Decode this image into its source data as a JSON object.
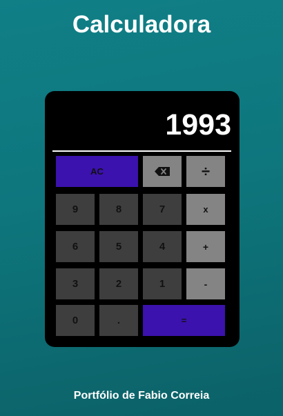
{
  "header": {
    "title": "Calculadora"
  },
  "display": {
    "value": "1993"
  },
  "keys": {
    "ac": "AC",
    "divide": "÷",
    "multiply": "x",
    "add": "+",
    "subtract": "-",
    "equals": "=",
    "decimal": ".",
    "d0": "0",
    "d1": "1",
    "d2": "2",
    "d3": "3",
    "d4": "4",
    "d5": "5",
    "d6": "6",
    "d7": "7",
    "d8": "8",
    "d9": "9"
  },
  "icons": {
    "backspace": "backspace-icon"
  },
  "colors": {
    "background_top": "#107f86",
    "background_bottom": "#0b6167",
    "accent_key": "#3b12ad",
    "number_key": "#3e3e3e",
    "operator_key": "#848484",
    "calculator_body": "#000000"
  },
  "footer": {
    "text": "Portfólio de Fabio Correia"
  }
}
